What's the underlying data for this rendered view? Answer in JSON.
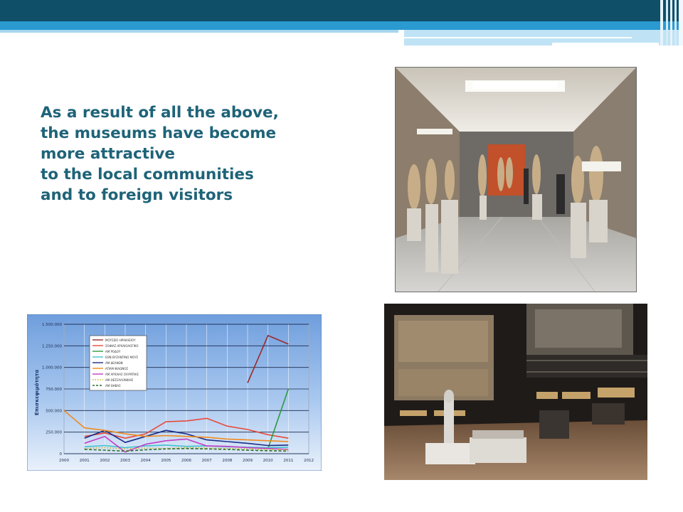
{
  "slide": {
    "headline_lines": [
      "As a result of all the above,",
      "the museums have become",
      "more attractive",
      "to the local communities",
      "and to foreign visitors"
    ],
    "colors": {
      "accent_dark": "#0f4f68",
      "accent_light": "#2a9ad1",
      "headline_text": "#1e6378"
    }
  },
  "photos": [
    {
      "subject": "museum-gallery-with-statues"
    },
    {
      "subject": "museum-exhibit-hall"
    }
  ],
  "chart_data": {
    "type": "line",
    "title": "",
    "xlabel": "",
    "ylabel": "Επισκεψιμότητα",
    "ylim": [
      0,
      1500000
    ],
    "grid": true,
    "legend_placement": "top-left",
    "x": [
      "2000",
      "2001",
      "2002",
      "2003",
      "2004",
      "2005",
      "2006",
      "2007",
      "2008",
      "2009",
      "2010",
      "2011",
      "2012"
    ],
    "y_ticks": [
      {
        "value": 0,
        "label": "0"
      },
      {
        "value": 250000,
        "label": "250.000"
      },
      {
        "value": 500000,
        "label": "500.000"
      },
      {
        "value": 750000,
        "label": "750.000"
      },
      {
        "value": 1000000,
        "label": "1.000.000"
      },
      {
        "value": 1250000,
        "label": "1.250.000"
      },
      {
        "value": 1500000,
        "label": "1.500.000"
      }
    ],
    "series": [
      {
        "name": "ΜΟΥΣΕΙΟ ΗΡΑΚΛΕΙΟΥ",
        "color": "#9b2a2a",
        "dash": "solid",
        "values": [
          null,
          null,
          null,
          null,
          null,
          null,
          null,
          null,
          null,
          820000,
          1370000,
          1270000,
          null
        ]
      },
      {
        "name": "ΣΟΦΙΑΣ ΑΡΧΑΙΟΛΟΓΙΚΟ",
        "color": "#e84a3a",
        "dash": "solid",
        "values": [
          null,
          200000,
          240000,
          180000,
          230000,
          370000,
          380000,
          410000,
          320000,
          280000,
          220000,
          180000,
          null
        ]
      },
      {
        "name": "ΑΜ ΡΟΔΟΥ",
        "color": "#2e9a3e",
        "dash": "solid",
        "values": [
          null,
          null,
          null,
          null,
          null,
          null,
          null,
          null,
          null,
          null,
          60000,
          750000,
          null
        ]
      },
      {
        "name": "ΕΘΝ ΒΥΖΑΝΤΙΝΟ ΜΟΥΣ",
        "color": "#43c0cf",
        "dash": "solid",
        "values": [
          null,
          80000,
          95000,
          70000,
          90000,
          100000,
          85000,
          90000,
          80000,
          75000,
          70000,
          75000,
          null
        ]
      },
      {
        "name": "ΑΜ ΔΕΛΦΩΝ",
        "color": "#1a2c86",
        "dash": "solid",
        "values": [
          null,
          180000,
          270000,
          130000,
          200000,
          270000,
          230000,
          160000,
          140000,
          120000,
          95000,
          100000,
          null
        ]
      },
      {
        "name": "ΑΠΑΜ ΦΙΛΩΝΟΣ",
        "color": "#f08a1e",
        "dash": "solid",
        "values": [
          500000,
          300000,
          270000,
          230000,
          200000,
          210000,
          200000,
          190000,
          170000,
          160000,
          150000,
          140000,
          null
        ]
      },
      {
        "name": "ΑΜ ΑΡΧΑΙΑΣ ΟΛΥΜΠΙΑΣ",
        "color": "#c43cc4",
        "dash": "solid",
        "values": [
          null,
          120000,
          200000,
          20000,
          110000,
          150000,
          170000,
          90000,
          85000,
          70000,
          60000,
          50000,
          null
        ]
      },
      {
        "name": "ΑΜ ΘΕΣΣΑΛΟΝΙΚΗΣ",
        "color": "#c9b41e",
        "dash": "dotted",
        "values": [
          null,
          60000,
          70000,
          55000,
          65000,
          60000,
          70000,
          65000,
          60000,
          55000,
          50000,
          45000,
          null
        ]
      },
      {
        "name": "ΑΜ ΘΗΒΑΣ",
        "color": "#2b6b2b",
        "dash": "dashed",
        "values": [
          null,
          50000,
          40000,
          30000,
          45000,
          55000,
          60000,
          55000,
          50000,
          40000,
          35000,
          30000,
          null
        ]
      }
    ]
  }
}
